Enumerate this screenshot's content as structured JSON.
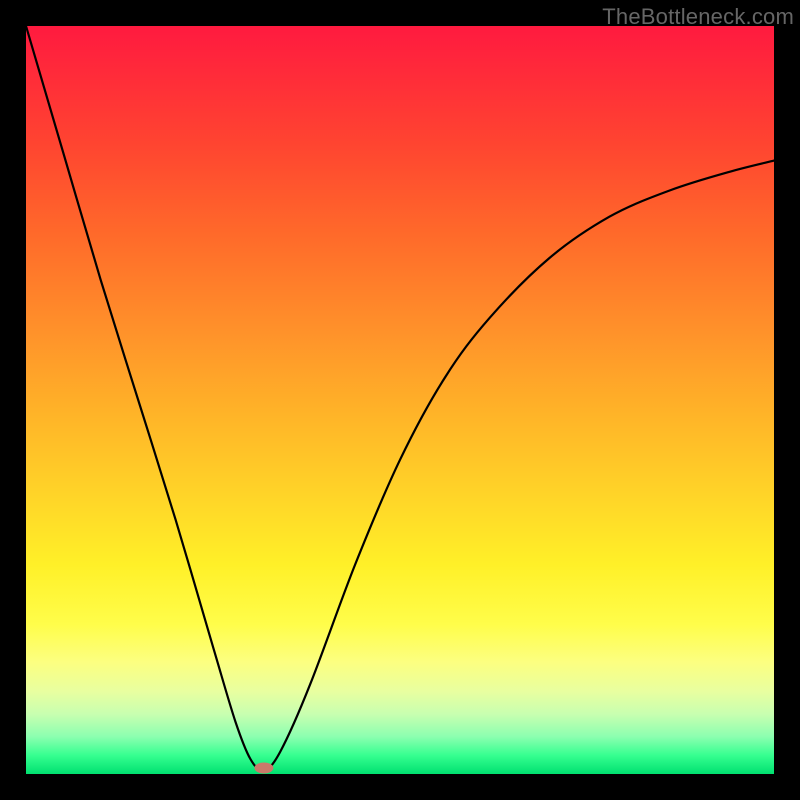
{
  "watermark": "TheBottleneck.com",
  "colors": {
    "frame": "#000000",
    "curve": "#000000",
    "knob": "#c97a6a",
    "gradient_top": "#ff1a3f",
    "gradient_bottom": "#00e070"
  },
  "chart_data": {
    "type": "line",
    "title": "",
    "xlabel": "",
    "ylabel": "",
    "xlim": [
      0,
      100
    ],
    "ylim": [
      0,
      100
    ],
    "grid": false,
    "series": [
      {
        "name": "bottleneck-curve",
        "x": [
          0,
          5,
          10,
          15,
          20,
          25,
          28,
          30,
          31.8,
          34,
          38,
          44,
          50,
          56,
          62,
          70,
          78,
          86,
          94,
          100
        ],
        "y": [
          100,
          83,
          66,
          50,
          34,
          17,
          7,
          2,
          0.5,
          3,
          12,
          28,
          42,
          53,
          61,
          69,
          74.5,
          78,
          80.5,
          82
        ]
      }
    ],
    "annotations": [
      {
        "name": "min-marker",
        "x": 31.8,
        "y": 0.5
      }
    ]
  }
}
